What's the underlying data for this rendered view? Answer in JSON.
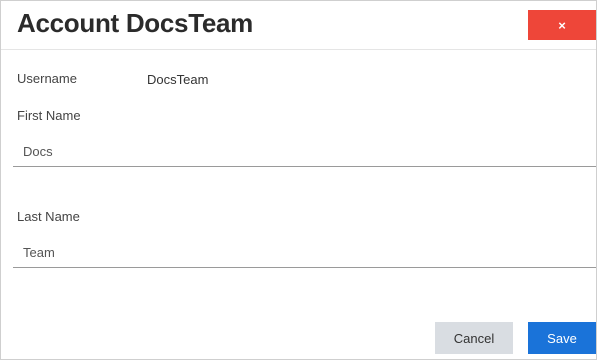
{
  "dialog": {
    "title": "Account DocsTeam",
    "close_label": "×"
  },
  "form": {
    "username_label": "Username",
    "username_value": "DocsTeam",
    "first_name_label": "First Name",
    "first_name_value": "Docs",
    "last_name_label": "Last Name",
    "last_name_value": "Team"
  },
  "actions": {
    "cancel_label": "Cancel",
    "save_label": "Save"
  },
  "colors": {
    "close": "#ee4639",
    "save": "#1a73d9",
    "cancel": "#d9dde2"
  }
}
